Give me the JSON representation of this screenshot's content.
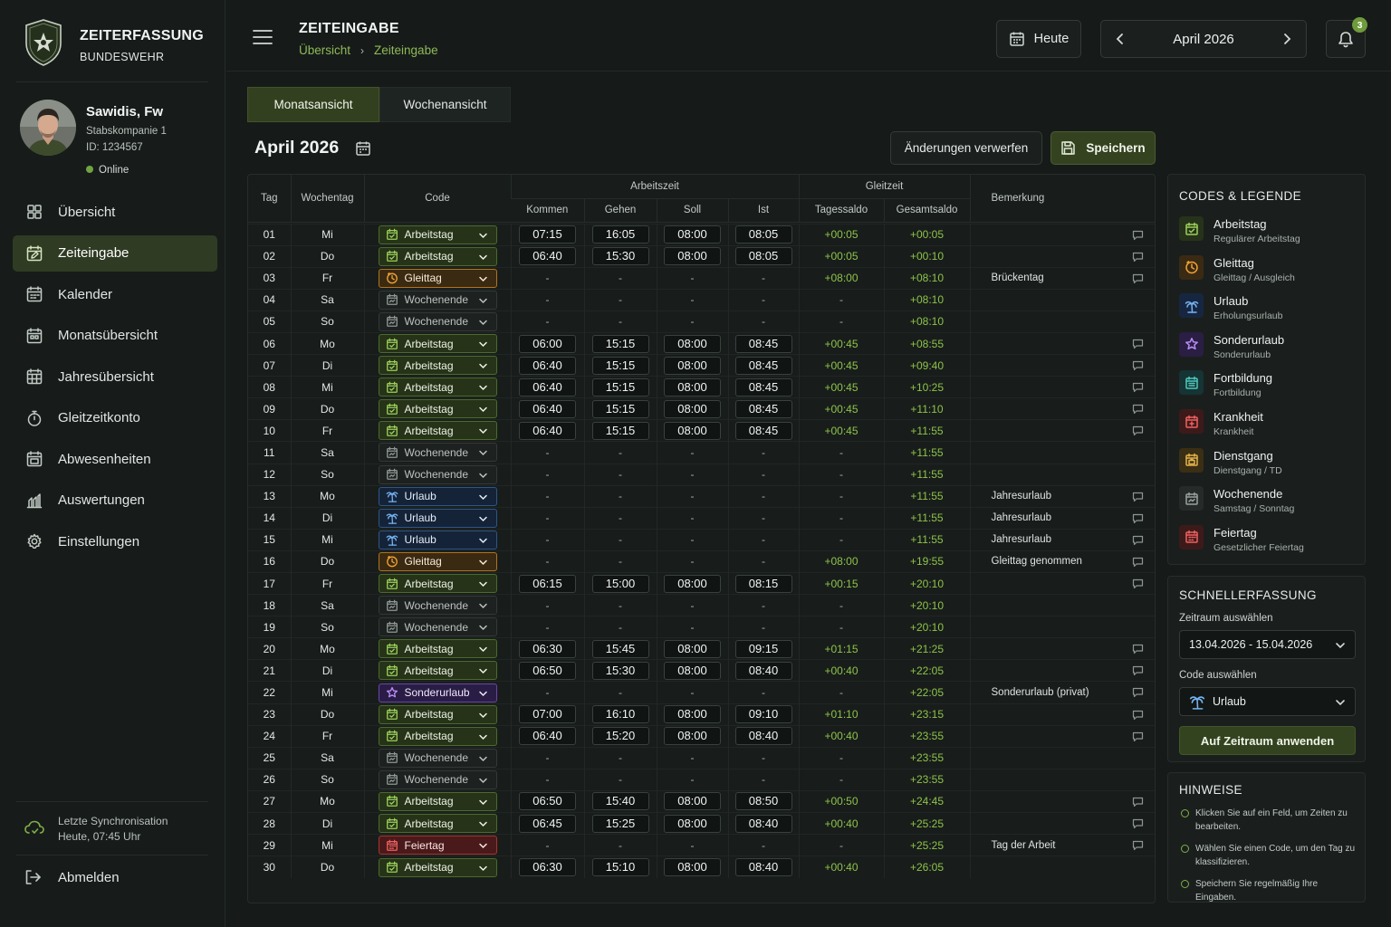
{
  "app": {
    "title": "ZEITERFASSUNG",
    "subtitle": "BUNDESWEHR"
  },
  "user": {
    "name": "Sawidis, Fw",
    "unit": "Stabskompanie 1",
    "id": "ID: 1234567",
    "status": "Online"
  },
  "nav": [
    {
      "label": "Übersicht",
      "icon": "dashboard-icon",
      "active": false
    },
    {
      "label": "Zeiteingabe",
      "icon": "calendar-edit-icon",
      "active": true
    },
    {
      "label": "Kalender",
      "icon": "calendar-icon",
      "active": false
    },
    {
      "label": "Monatsübersicht",
      "icon": "calendar-month-icon",
      "active": false
    },
    {
      "label": "Jahresübersicht",
      "icon": "calendar-grid-icon",
      "active": false
    },
    {
      "label": "Gleitzeitkonto",
      "icon": "stopwatch-icon",
      "active": false
    },
    {
      "label": "Abwesenheiten",
      "icon": "calendar-absence-icon",
      "active": false
    },
    {
      "label": "Auswertungen",
      "icon": "chart-icon",
      "active": false
    },
    {
      "label": "Einstellungen",
      "icon": "gear-icon",
      "active": false
    }
  ],
  "sync": {
    "line1": "Letzte Synchronisation",
    "line2": "Heute, 07:45 Uhr"
  },
  "logout_label": "Abmelden",
  "header": {
    "page_title": "ZEITEINGABE",
    "breadcrumb": [
      "Übersicht",
      "Zeiteingabe"
    ],
    "today_label": "Heute",
    "month_label": "April 2026",
    "notification_count": "3"
  },
  "tabs": [
    "Monatsansicht",
    "Wochenansicht"
  ],
  "month_title": "April 2026",
  "actions": {
    "discard": "Änderungen verwerfen",
    "save": "Speichern"
  },
  "table": {
    "headers": {
      "tag": "Tag",
      "wochentag": "Wochentag",
      "code": "Code",
      "arbeitszeit": "Arbeitszeit",
      "kommen": "Kommen",
      "gehen": "Gehen",
      "soll": "Soll",
      "ist": "Ist",
      "gleitzeit": "Gleitzeit",
      "tagessaldo": "Tagessaldo",
      "gesamtsaldo": "Gesamtsaldo",
      "bemerkung": "Bemerkung"
    },
    "rows": [
      {
        "tag": "01",
        "wt": "Mi",
        "code": "Arbeitstag",
        "k": "07:15",
        "g": "16:05",
        "s": "08:00",
        "i": "08:05",
        "ts": "+00:05",
        "gs": "+00:05",
        "bem": "",
        "cmt": true
      },
      {
        "tag": "02",
        "wt": "Do",
        "code": "Arbeitstag",
        "k": "06:40",
        "g": "15:30",
        "s": "08:00",
        "i": "08:05",
        "ts": "+00:05",
        "gs": "+00:10",
        "bem": "",
        "cmt": true
      },
      {
        "tag": "03",
        "wt": "Fr",
        "code": "Gleittag",
        "k": "-",
        "g": "-",
        "s": "-",
        "i": "-",
        "ts": "+08:00",
        "gs": "+08:10",
        "bem": "Brückentag",
        "cmt": true
      },
      {
        "tag": "04",
        "wt": "Sa",
        "code": "Wochenende",
        "k": "-",
        "g": "-",
        "s": "-",
        "i": "-",
        "ts": "-",
        "gs": "+08:10",
        "bem": "",
        "cmt": false
      },
      {
        "tag": "05",
        "wt": "So",
        "code": "Wochenende",
        "k": "-",
        "g": "-",
        "s": "-",
        "i": "-",
        "ts": "-",
        "gs": "+08:10",
        "bem": "",
        "cmt": false
      },
      {
        "tag": "06",
        "wt": "Mo",
        "code": "Arbeitstag",
        "k": "06:00",
        "g": "15:15",
        "s": "08:00",
        "i": "08:45",
        "ts": "+00:45",
        "gs": "+08:55",
        "bem": "",
        "cmt": true
      },
      {
        "tag": "07",
        "wt": "Di",
        "code": "Arbeitstag",
        "k": "06:40",
        "g": "15:15",
        "s": "08:00",
        "i": "08:45",
        "ts": "+00:45",
        "gs": "+09:40",
        "bem": "",
        "cmt": true
      },
      {
        "tag": "08",
        "wt": "Mi",
        "code": "Arbeitstag",
        "k": "06:40",
        "g": "15:15",
        "s": "08:00",
        "i": "08:45",
        "ts": "+00:45",
        "gs": "+10:25",
        "bem": "",
        "cmt": true
      },
      {
        "tag": "09",
        "wt": "Do",
        "code": "Arbeitstag",
        "k": "06:40",
        "g": "15:15",
        "s": "08:00",
        "i": "08:45",
        "ts": "+00:45",
        "gs": "+11:10",
        "bem": "",
        "cmt": true
      },
      {
        "tag": "10",
        "wt": "Fr",
        "code": "Arbeitstag",
        "k": "06:40",
        "g": "15:15",
        "s": "08:00",
        "i": "08:45",
        "ts": "+00:45",
        "gs": "+11:55",
        "bem": "",
        "cmt": true
      },
      {
        "tag": "11",
        "wt": "Sa",
        "code": "Wochenende",
        "k": "-",
        "g": "-",
        "s": "-",
        "i": "-",
        "ts": "-",
        "gs": "+11:55",
        "bem": "",
        "cmt": false
      },
      {
        "tag": "12",
        "wt": "So",
        "code": "Wochenende",
        "k": "-",
        "g": "-",
        "s": "-",
        "i": "-",
        "ts": "-",
        "gs": "+11:55",
        "bem": "",
        "cmt": false
      },
      {
        "tag": "13",
        "wt": "Mo",
        "code": "Urlaub",
        "k": "-",
        "g": "-",
        "s": "-",
        "i": "-",
        "ts": "-",
        "gs": "+11:55",
        "bem": "Jahresurlaub",
        "cmt": true
      },
      {
        "tag": "14",
        "wt": "Di",
        "code": "Urlaub",
        "k": "-",
        "g": "-",
        "s": "-",
        "i": "-",
        "ts": "-",
        "gs": "+11:55",
        "bem": "Jahresurlaub",
        "cmt": true
      },
      {
        "tag": "15",
        "wt": "Mi",
        "code": "Urlaub",
        "k": "-",
        "g": "-",
        "s": "-",
        "i": "-",
        "ts": "-",
        "gs": "+11:55",
        "bem": "Jahresurlaub",
        "cmt": true
      },
      {
        "tag": "16",
        "wt": "Do",
        "code": "Gleittag",
        "k": "-",
        "g": "-",
        "s": "-",
        "i": "-",
        "ts": "+08:00",
        "gs": "+19:55",
        "bem": "Gleittag genommen",
        "cmt": true
      },
      {
        "tag": "17",
        "wt": "Fr",
        "code": "Arbeitstag",
        "k": "06:15",
        "g": "15:00",
        "s": "08:00",
        "i": "08:15",
        "ts": "+00:15",
        "gs": "+20:10",
        "bem": "",
        "cmt": true
      },
      {
        "tag": "18",
        "wt": "Sa",
        "code": "Wochenende",
        "k": "-",
        "g": "-",
        "s": "-",
        "i": "-",
        "ts": "-",
        "gs": "+20:10",
        "bem": "",
        "cmt": false
      },
      {
        "tag": "19",
        "wt": "So",
        "code": "Wochenende",
        "k": "-",
        "g": "-",
        "s": "-",
        "i": "-",
        "ts": "-",
        "gs": "+20:10",
        "bem": "",
        "cmt": false
      },
      {
        "tag": "20",
        "wt": "Mo",
        "code": "Arbeitstag",
        "k": "06:30",
        "g": "15:45",
        "s": "08:00",
        "i": "09:15",
        "ts": "+01:15",
        "gs": "+21:25",
        "bem": "",
        "cmt": true
      },
      {
        "tag": "21",
        "wt": "Di",
        "code": "Arbeitstag",
        "k": "06:50",
        "g": "15:30",
        "s": "08:00",
        "i": "08:40",
        "ts": "+00:40",
        "gs": "+22:05",
        "bem": "",
        "cmt": true
      },
      {
        "tag": "22",
        "wt": "Mi",
        "code": "Sonderurlaub",
        "k": "-",
        "g": "-",
        "s": "-",
        "i": "-",
        "ts": "-",
        "gs": "+22:05",
        "bem": "Sonderurlaub (privat)",
        "cmt": true
      },
      {
        "tag": "23",
        "wt": "Do",
        "code": "Arbeitstag",
        "k": "07:00",
        "g": "16:10",
        "s": "08:00",
        "i": "09:10",
        "ts": "+01:10",
        "gs": "+23:15",
        "bem": "",
        "cmt": true
      },
      {
        "tag": "24",
        "wt": "Fr",
        "code": "Arbeitstag",
        "k": "06:40",
        "g": "15:20",
        "s": "08:00",
        "i": "08:40",
        "ts": "+00:40",
        "gs": "+23:55",
        "bem": "",
        "cmt": true
      },
      {
        "tag": "25",
        "wt": "Sa",
        "code": "Wochenende",
        "k": "-",
        "g": "-",
        "s": "-",
        "i": "-",
        "ts": "-",
        "gs": "+23:55",
        "bem": "",
        "cmt": false
      },
      {
        "tag": "26",
        "wt": "So",
        "code": "Wochenende",
        "k": "-",
        "g": "-",
        "s": "-",
        "i": "-",
        "ts": "-",
        "gs": "+23:55",
        "bem": "",
        "cmt": false
      },
      {
        "tag": "27",
        "wt": "Mo",
        "code": "Arbeitstag",
        "k": "06:50",
        "g": "15:40",
        "s": "08:00",
        "i": "08:50",
        "ts": "+00:50",
        "gs": "+24:45",
        "bem": "",
        "cmt": true
      },
      {
        "tag": "28",
        "wt": "Di",
        "code": "Arbeitstag",
        "k": "06:45",
        "g": "15:25",
        "s": "08:00",
        "i": "08:40",
        "ts": "+00:40",
        "gs": "+25:25",
        "bem": "",
        "cmt": true
      },
      {
        "tag": "29",
        "wt": "Mi",
        "code": "Feiertag",
        "k": "-",
        "g": "-",
        "s": "-",
        "i": "-",
        "ts": "-",
        "gs": "+25:25",
        "bem": "Tag der Arbeit",
        "cmt": true
      },
      {
        "tag": "30",
        "wt": "Do",
        "code": "Arbeitstag",
        "k": "06:30",
        "g": "15:10",
        "s": "08:00",
        "i": "08:40",
        "ts": "+00:40",
        "gs": "+26:05",
        "bem": "",
        "cmt": false
      }
    ]
  },
  "legend": {
    "title": "CODES & LEGENDE",
    "items": [
      {
        "name": "Arbeitstag",
        "desc": "Regulärer Arbeitstag",
        "color": "#9bd05a",
        "bg": "#26331a",
        "icon": "calendar-check-icon"
      },
      {
        "name": "Gleittag",
        "desc": "Gleittag / Ausgleich",
        "color": "#f0a233",
        "bg": "#3a2a14",
        "icon": "calendar-clock-icon"
      },
      {
        "name": "Urlaub",
        "desc": "Erholungsurlaub",
        "color": "#74b3f2",
        "bg": "#172640",
        "icon": "palm-tree-icon"
      },
      {
        "name": "Sonderurlaub",
        "desc": "Sonderurlaub",
        "color": "#b88cf3",
        "bg": "#2a1e44",
        "icon": "calendar-star-icon"
      },
      {
        "name": "Fortbildung",
        "desc": "Fortbildung",
        "color": "#4fc8bd",
        "bg": "#153433",
        "icon": "calendar-book-icon"
      },
      {
        "name": "Krankheit",
        "desc": "Krankheit",
        "color": "#f06060",
        "bg": "#3d1a1a",
        "icon": "calendar-medical-icon"
      },
      {
        "name": "Dienstgang",
        "desc": "Dienstgang / TD",
        "color": "#e2b24a",
        "bg": "#3a2e14",
        "icon": "calendar-briefcase-icon"
      },
      {
        "name": "Wochenende",
        "desc": "Samstag / Sonntag",
        "color": "#9aa29e",
        "bg": "#262b29",
        "icon": "calendar-weekend-icon"
      },
      {
        "name": "Feiertag",
        "desc": "Gesetzlicher Feiertag",
        "color": "#f06060",
        "bg": "#3d1a1a",
        "icon": "calendar-holiday-icon"
      }
    ]
  },
  "quick": {
    "title": "SCHNELLERFASSUNG",
    "range_label": "Zeitraum auswählen",
    "range_value": "13.04.2026 - 15.04.2026",
    "code_label": "Code auswählen",
    "code_value": "Urlaub",
    "apply": "Auf Zeitraum anwenden"
  },
  "hints": {
    "title": "HINWEISE",
    "items": [
      "Klicken Sie auf ein Feld, um Zeiten zu bearbeiten.",
      "Wählen Sie einen Code, um den Tag zu klassifizieren.",
      "Speichern Sie regelmäßig Ihre Eingaben."
    ]
  }
}
